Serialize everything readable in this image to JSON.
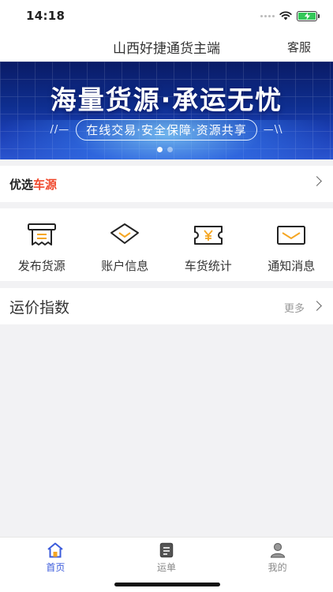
{
  "status_bar": {
    "time": "14:18"
  },
  "nav": {
    "title": "山西好捷通货主端",
    "right_action": "客服"
  },
  "banner": {
    "headline": "海量货源·承运无忧",
    "tagline": "在线交易·安全保障·资源共享",
    "decor_left": "//—",
    "decor_right": "—\\\\",
    "dots_count": 2,
    "active_dot": 1
  },
  "featured": {
    "title_part1": "优选",
    "title_part2": "车源",
    "accent_color": "#f04a2e"
  },
  "quick_actions": [
    {
      "label": "发布货源",
      "icon": "receipt-icon"
    },
    {
      "label": "账户信息",
      "icon": "wallet-icon"
    },
    {
      "label": "车货统计",
      "icon": "ticket-yen-icon"
    },
    {
      "label": "通知消息",
      "icon": "envelope-icon"
    }
  ],
  "freight_index": {
    "title": "运价指数",
    "more": "更多"
  },
  "tabbar": {
    "active_color": "#3b5bdb",
    "items": [
      {
        "label": "首页",
        "icon": "home-icon",
        "active": true
      },
      {
        "label": "运单",
        "icon": "document-icon",
        "active": false
      },
      {
        "label": "我的",
        "icon": "user-icon",
        "active": false
      }
    ]
  }
}
